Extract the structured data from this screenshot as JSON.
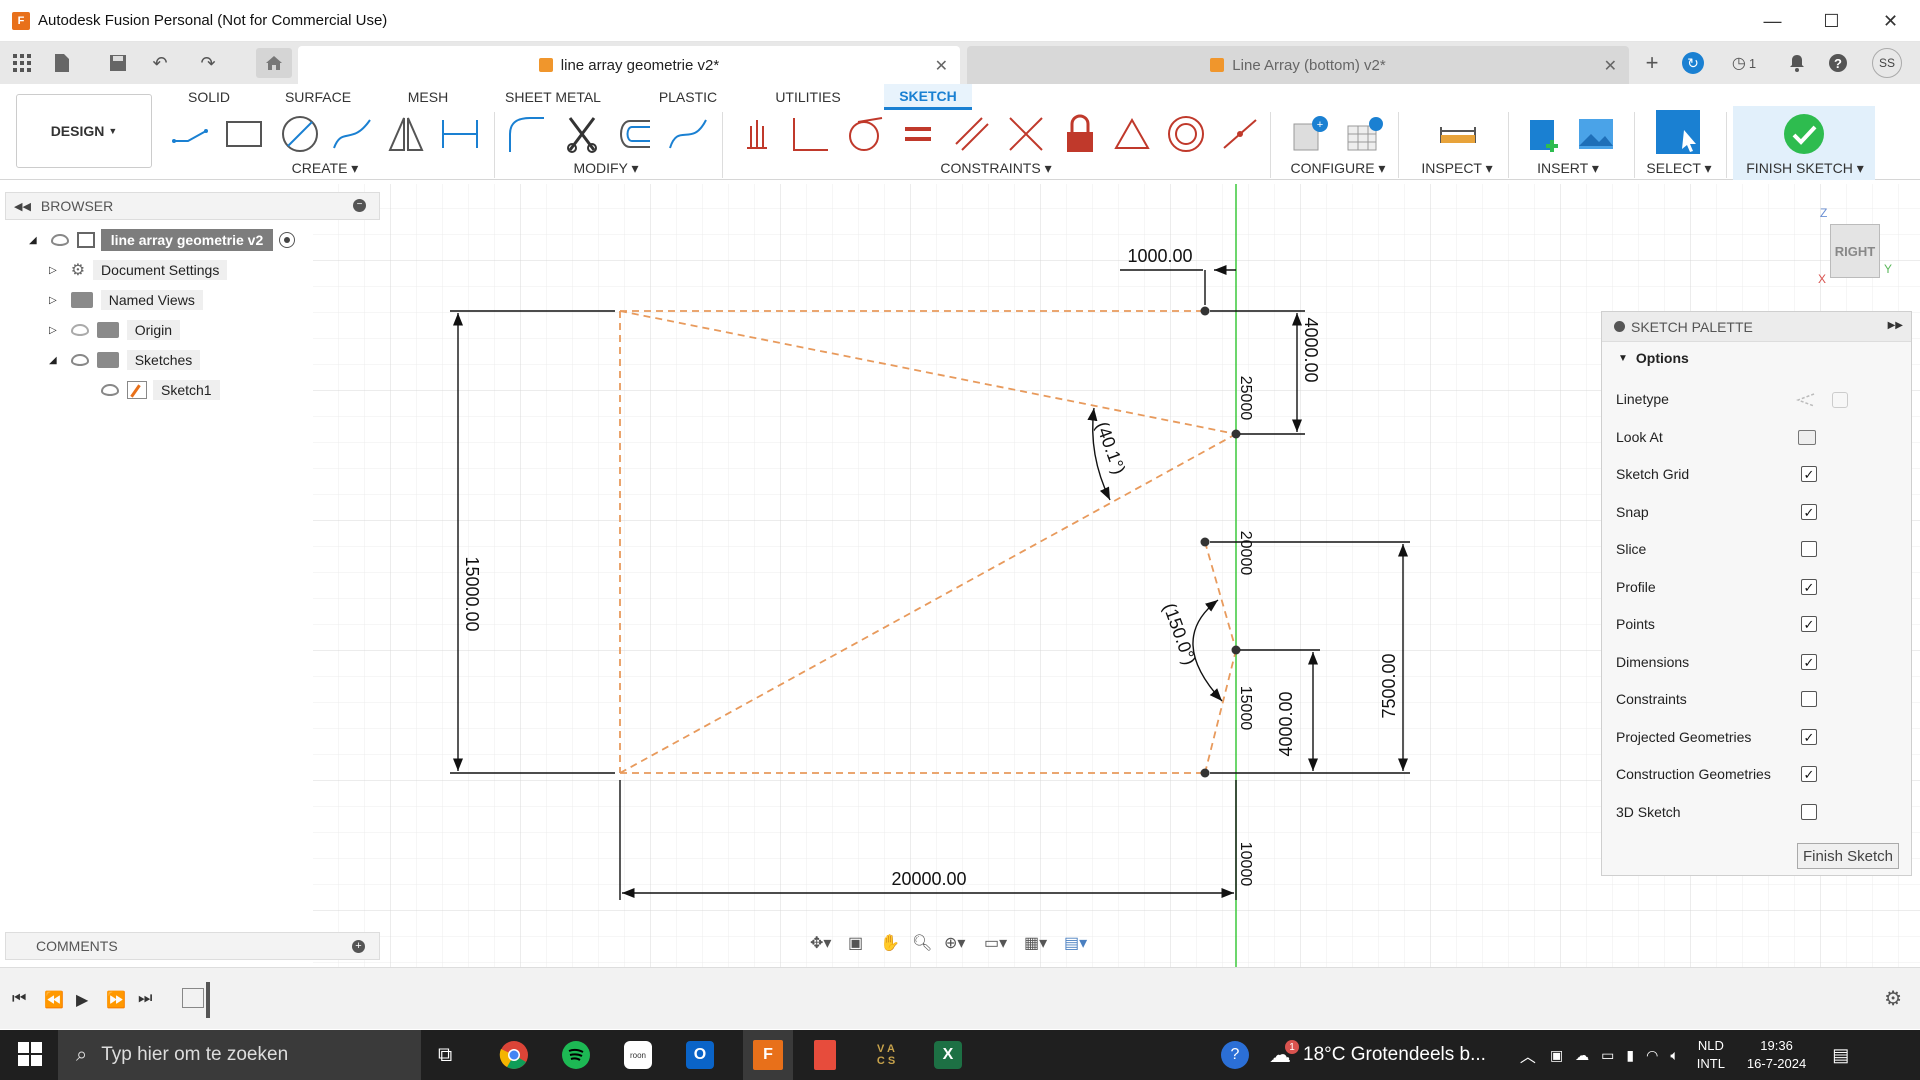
{
  "window": {
    "title": "Autodesk Fusion Personal (Not for Commercial Use)",
    "app_badge": "F",
    "controls": [
      "—",
      "☐",
      "✕"
    ]
  },
  "tabs": [
    {
      "label": "line array geometrie v2*",
      "active": true
    },
    {
      "label": "Line Array (bottom) v2*",
      "active": false
    }
  ],
  "tabbar": {
    "job_count": "1",
    "user_initials": "SS"
  },
  "toolbar": {
    "design_label": "DESIGN",
    "workspaces": [
      "SOLID",
      "SURFACE",
      "MESH",
      "SHEET METAL",
      "PLASTIC",
      "UTILITIES",
      "SKETCH"
    ],
    "groups": {
      "create": "CREATE",
      "modify": "MODIFY",
      "constraints": "CONSTRAINTS",
      "configure": "CONFIGURE",
      "inspect": "INSPECT",
      "insert": "INSERT",
      "select": "SELECT",
      "finish": "FINISH SKETCH"
    }
  },
  "browser": {
    "title": "BROWSER",
    "root": "line array geometrie v2",
    "items": [
      "Document Settings",
      "Named Views",
      "Origin",
      "Sketches",
      "Sketch1"
    ]
  },
  "comments": {
    "title": "COMMENTS"
  },
  "sketch": {
    "dimensions": {
      "top_offset": "1000.00",
      "right_top": "4000.00",
      "left_height": "15000.00",
      "bottom_width": "20000.00",
      "right_height": "7500.00",
      "right_bottom": "4000.00",
      "angle_top": "(40.1°)",
      "angle_mid": "(150.0°)"
    },
    "axis_labels": [
      "25000",
      "20000",
      "15000",
      "10000"
    ]
  },
  "viewcube": {
    "face": "RIGHT",
    "axis_z": "Z",
    "axis_y": "Y",
    "axis_x": "X"
  },
  "palette": {
    "title": "SKETCH PALETTE",
    "section": "Options",
    "rows": [
      {
        "label": "Linetype",
        "type": "icon"
      },
      {
        "label": "Look At",
        "type": "icon"
      },
      {
        "label": "Sketch Grid",
        "checked": true
      },
      {
        "label": "Snap",
        "checked": true
      },
      {
        "label": "Slice",
        "checked": false
      },
      {
        "label": "Profile",
        "checked": true
      },
      {
        "label": "Points",
        "checked": true
      },
      {
        "label": "Dimensions",
        "checked": true
      },
      {
        "label": "Constraints",
        "checked": false
      },
      {
        "label": "Projected Geometries",
        "checked": true
      },
      {
        "label": "Construction Geometries",
        "checked": true
      },
      {
        "label": "3D Sketch",
        "checked": false
      }
    ],
    "finish_button": "Finish Sketch"
  },
  "taskbar": {
    "search_placeholder": "Typ hier om te zoeken",
    "weather": "18°C  Grotendeels b...",
    "weather_badge": "1",
    "lang_top": "NLD",
    "lang_bottom": "INTL",
    "time": "19:36",
    "date": "16-7-2024"
  },
  "colors": {
    "accent": "#1a80d2",
    "construction_line": "#e89a5c",
    "finish_green": "#2ebc4f",
    "axis_green": "#3cc83c"
  }
}
